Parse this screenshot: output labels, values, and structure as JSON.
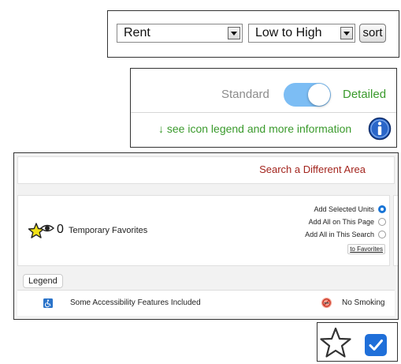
{
  "sort": {
    "rent_value": "Rent",
    "order_value": "Low to High",
    "sort_label": "sort"
  },
  "view": {
    "standard_label": "Standard",
    "detailed_label": "Detailed",
    "toggle_state": "on",
    "legend_link": "↓ see icon legend and more information"
  },
  "search_area": {
    "different_area_link": "Search a Different Area",
    "favorites_count": "0",
    "favorites_label": "Temporary Favorites",
    "options": [
      {
        "label": "Add Selected Units",
        "selected": true
      },
      {
        "label": "Add All on This Page",
        "selected": false
      },
      {
        "label": "Add All in This Search",
        "selected": false
      }
    ],
    "to_favorites_label": "to Favorites",
    "legend_tab": "Legend",
    "legend_items": [
      {
        "icon": "accessibility-icon",
        "label": "Some Accessibility Features Included"
      },
      {
        "icon": "no-smoking-icon",
        "label": "No Smoking"
      }
    ]
  },
  "colors": {
    "toggle_on": "#7cbdf4",
    "green_text": "#3a9a2c",
    "link_red": "#a3251e",
    "radio_blue": "#1874d6",
    "check_blue": "#1f6fd9"
  },
  "icons": {
    "favorites": "star-eye-icon",
    "info": "info-icon",
    "star": "star-outline-icon",
    "check": "checkbox-checked-icon"
  }
}
